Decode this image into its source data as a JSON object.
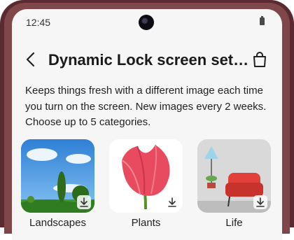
{
  "status_bar": {
    "time": "12:45"
  },
  "header": {
    "title": "Dynamic Lock screen settin..."
  },
  "description": "Keeps things fresh with a different image each time you turn on the screen. New images every 2 weeks. Choose up to 5 categories.",
  "categories": [
    {
      "label": "Landscapes",
      "icon": "download-icon"
    },
    {
      "label": "Plants",
      "icon": "download-icon"
    },
    {
      "label": "Life",
      "icon": "download-icon"
    }
  ],
  "colors": {
    "frame": "#5a2a30",
    "screen": "#f7f6f6"
  }
}
